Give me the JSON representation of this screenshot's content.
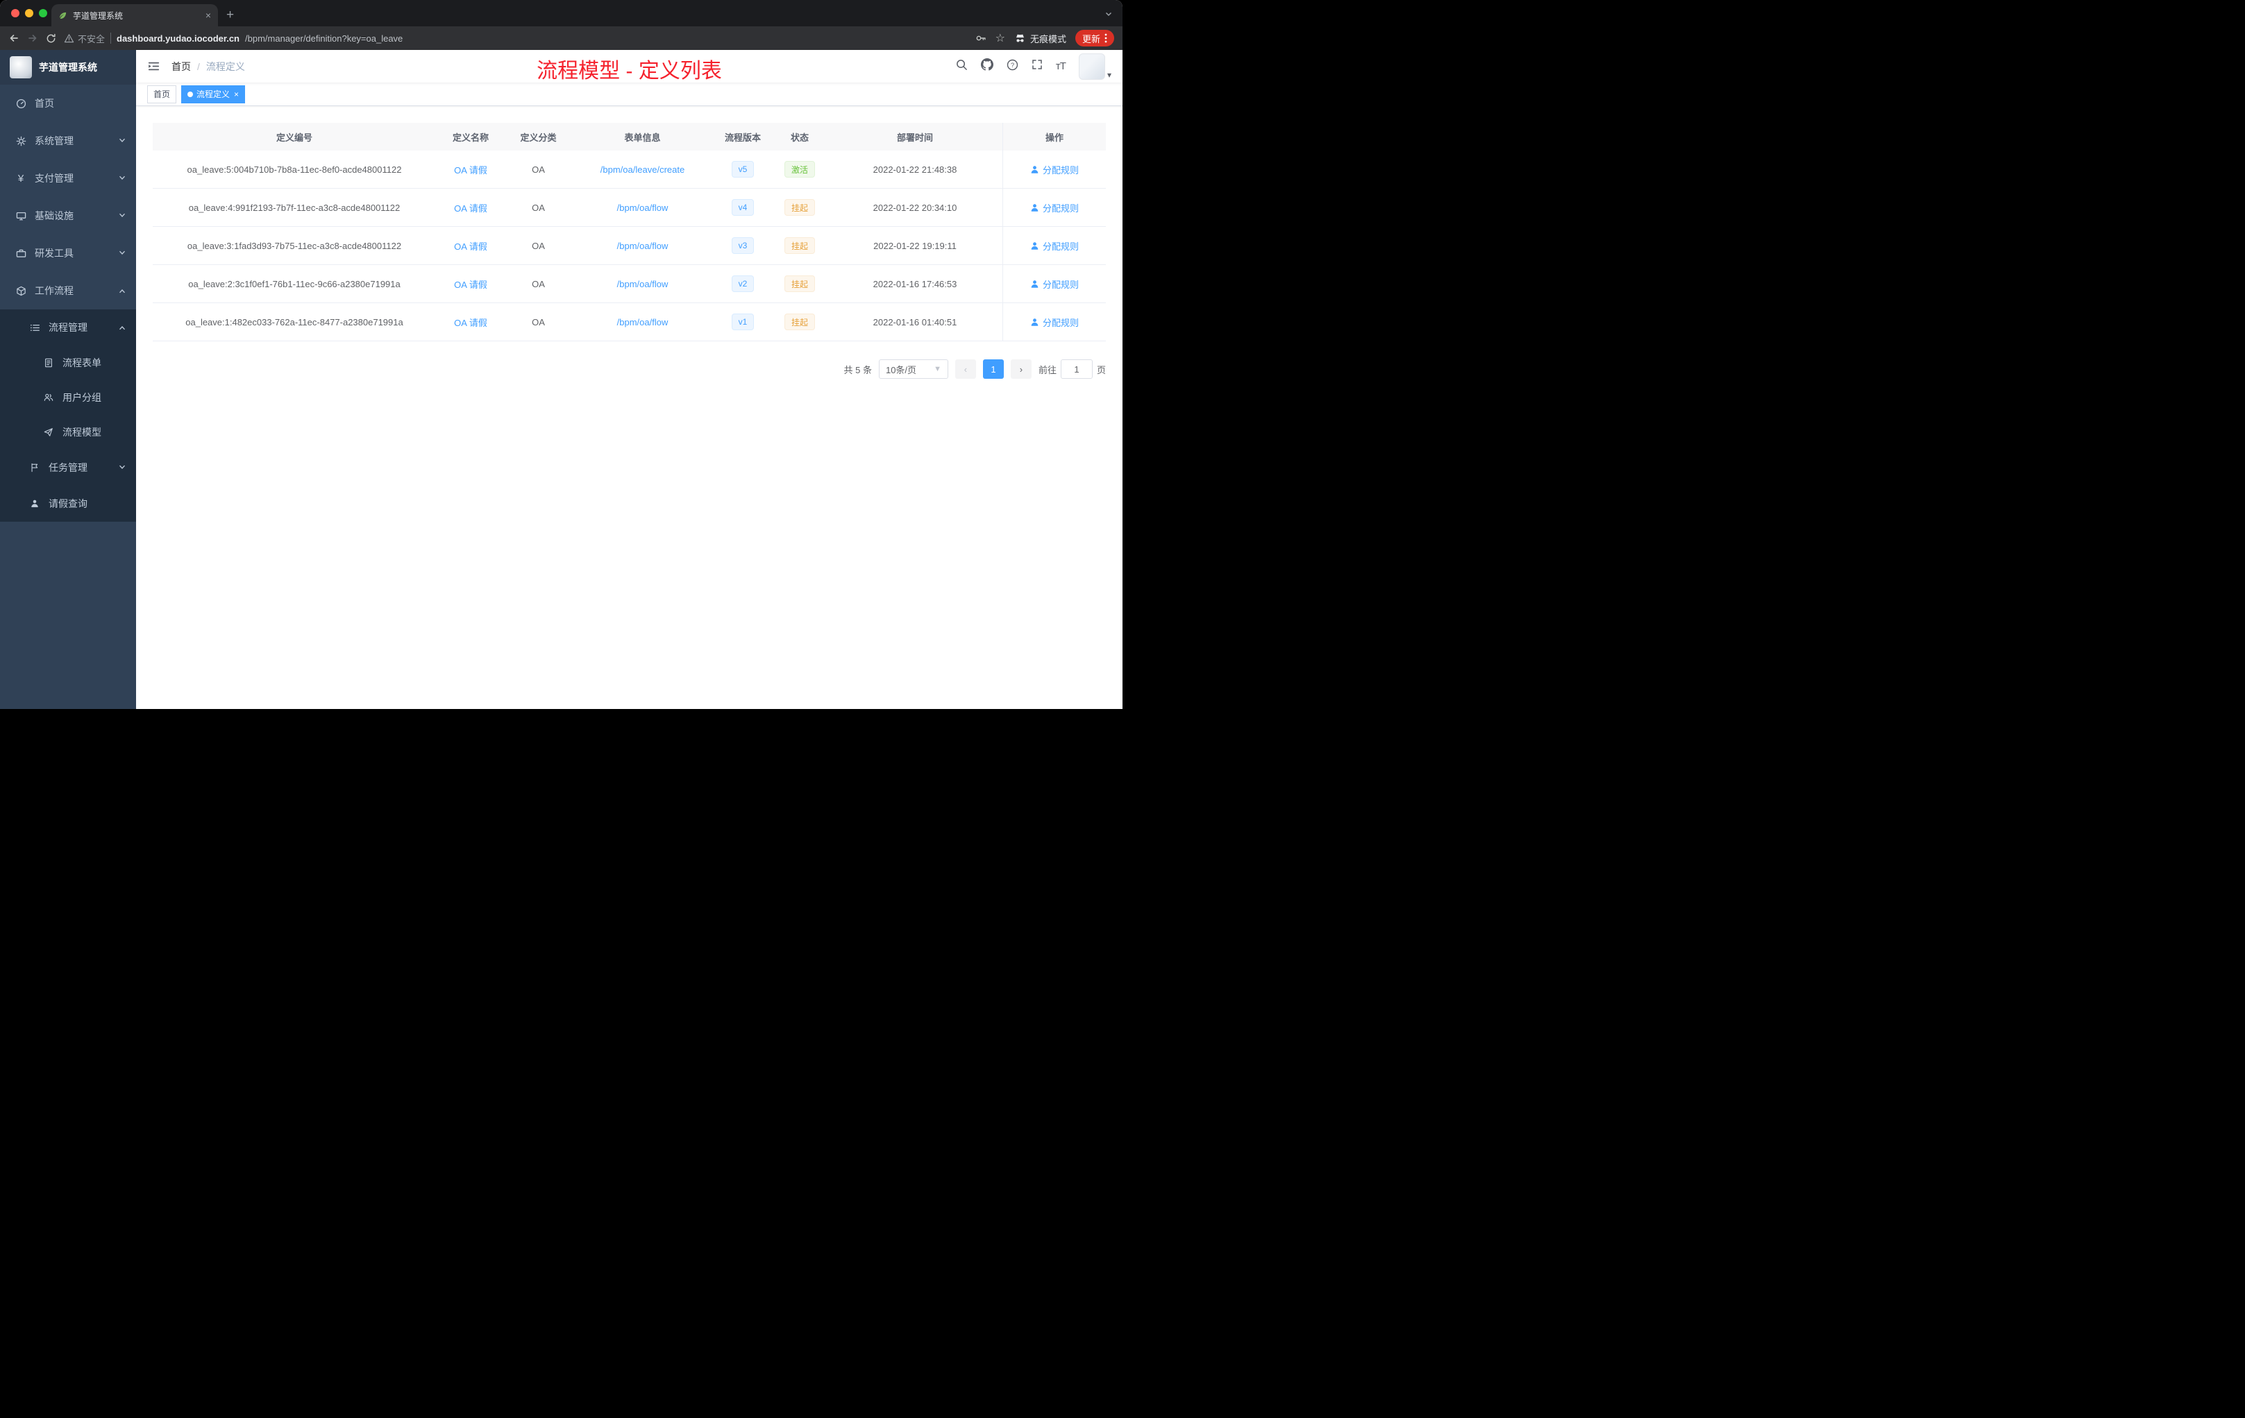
{
  "browser": {
    "tab_title": "芋道管理系统",
    "security_label": "不安全",
    "url_host": "dashboard.yudao.iocoder.cn",
    "url_path": "/bpm/manager/definition?key=oa_leave",
    "incognito_label": "无痕模式",
    "update_label": "更新"
  },
  "sidebar": {
    "app_title": "芋道管理系统",
    "items": [
      {
        "label": "首页"
      },
      {
        "label": "系统管理"
      },
      {
        "label": "支付管理"
      },
      {
        "label": "基础设施"
      },
      {
        "label": "研发工具"
      },
      {
        "label": "工作流程"
      }
    ],
    "submenu": {
      "manage_label": "流程管理",
      "leaves": [
        {
          "label": "流程表单"
        },
        {
          "label": "用户分组"
        },
        {
          "label": "流程模型"
        }
      ],
      "task_label": "任务管理",
      "leave_query_label": "请假查询"
    }
  },
  "header": {
    "breadcrumb_home": "首页",
    "breadcrumb_current": "流程定义",
    "annotation_title": "流程模型 - 定义列表"
  },
  "tags": [
    {
      "label": "首页"
    },
    {
      "label": "流程定义"
    }
  ],
  "table": {
    "columns": [
      "定义编号",
      "定义名称",
      "定义分类",
      "表单信息",
      "流程版本",
      "状态",
      "部署时间",
      "操作"
    ],
    "rows": [
      {
        "id": "oa_leave:5:004b710b-7b8a-11ec-8ef0-acde48001122",
        "name": "OA 请假",
        "category": "OA",
        "form": "/bpm/oa/leave/create",
        "version": "v5",
        "status": {
          "label": "激活",
          "type": "success"
        },
        "deploy_time": "2022-01-22 21:48:38",
        "action": "分配规则"
      },
      {
        "id": "oa_leave:4:991f2193-7b7f-11ec-a3c8-acde48001122",
        "name": "OA 请假",
        "category": "OA",
        "form": "/bpm/oa/flow",
        "version": "v4",
        "status": {
          "label": "挂起",
          "type": "warning"
        },
        "deploy_time": "2022-01-22 20:34:10",
        "action": "分配规则"
      },
      {
        "id": "oa_leave:3:1fad3d93-7b75-11ec-a3c8-acde48001122",
        "name": "OA 请假",
        "category": "OA",
        "form": "/bpm/oa/flow",
        "version": "v3",
        "status": {
          "label": "挂起",
          "type": "warning"
        },
        "deploy_time": "2022-01-22 19:19:11",
        "action": "分配规则"
      },
      {
        "id": "oa_leave:2:3c1f0ef1-76b1-11ec-9c66-a2380e71991a",
        "name": "OA 请假",
        "category": "OA",
        "form": "/bpm/oa/flow",
        "version": "v2",
        "status": {
          "label": "挂起",
          "type": "warning"
        },
        "deploy_time": "2022-01-16 17:46:53",
        "action": "分配规则"
      },
      {
        "id": "oa_leave:1:482ec033-762a-11ec-8477-a2380e71991a",
        "name": "OA 请假",
        "category": "OA",
        "form": "/bpm/oa/flow",
        "version": "v1",
        "status": {
          "label": "挂起",
          "type": "warning"
        },
        "deploy_time": "2022-01-16 01:40:51",
        "action": "分配规则"
      }
    ]
  },
  "pagination": {
    "total": "共 5 条",
    "page_size": "10条/页",
    "current_page": "1",
    "goto_prefix": "前往",
    "goto_value": "1",
    "goto_suffix": "页"
  },
  "colors": {
    "accent": "#409eff",
    "annotation_red": "#f5222d",
    "status_active": "#67c23a",
    "status_suspend": "#e6a23c",
    "sidebar_bg": "#304156",
    "submenu_bg": "#1f2d3d"
  }
}
